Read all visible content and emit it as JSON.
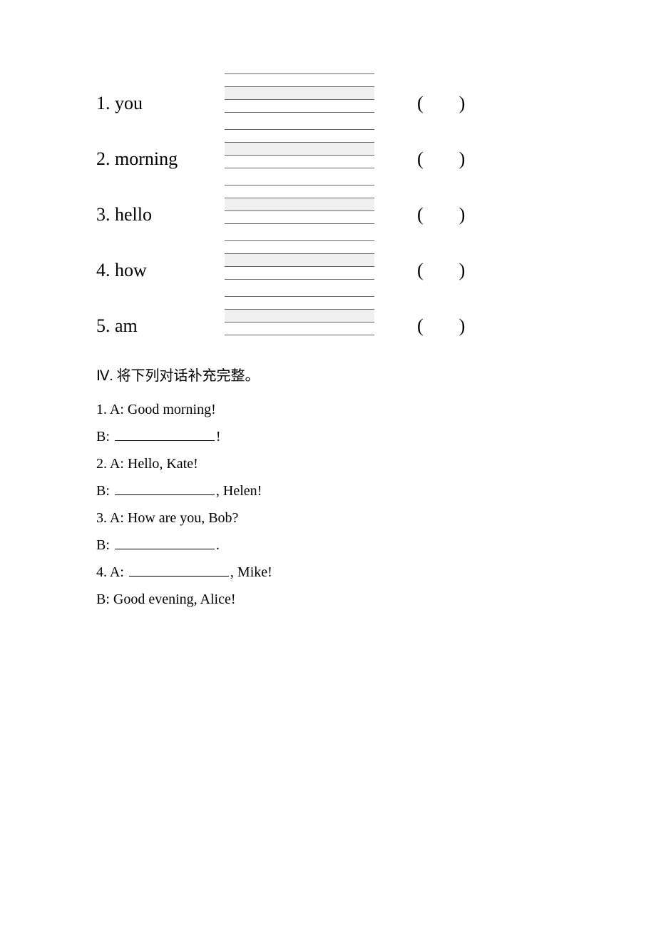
{
  "part1": {
    "items": [
      {
        "num": "1. ",
        "word": "you"
      },
      {
        "num": "2. ",
        "word": "morning"
      },
      {
        "num": "3. ",
        "word": "hello"
      },
      {
        "num": "4. ",
        "word": "how"
      },
      {
        "num": "5. ",
        "word": "am"
      }
    ],
    "paren_open": "(",
    "paren_close": ")"
  },
  "part2": {
    "title": "Ⅳ. 将下列对话补充完整。",
    "lines": [
      {
        "prefix": "1. A: Good morning!"
      },
      {
        "prefix": "B: ",
        "blank": true,
        "suffix": "!"
      },
      {
        "prefix": "2. A: Hello, Kate!"
      },
      {
        "prefix": "B: ",
        "blank": true,
        "suffix": ", Helen!"
      },
      {
        "prefix": "3. A: How are you, Bob?"
      },
      {
        "prefix": "B: ",
        "blank": true,
        "suffix": "."
      },
      {
        "prefix": "4. A: ",
        "blank": true,
        "suffix": ", Mike!"
      },
      {
        "prefix": "B: Good evening, Alice!"
      }
    ]
  }
}
